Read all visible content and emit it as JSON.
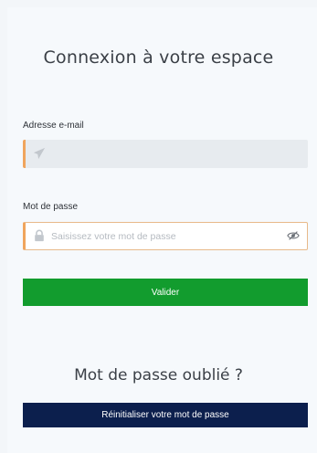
{
  "login": {
    "title": "Connexion à votre espace",
    "email_label": "Adresse e-mail",
    "email_value": "",
    "password_label": "Mot de passe",
    "password_placeholder": "Saisissez votre mot de passe",
    "password_value": "",
    "submit_label": "Valider"
  },
  "forgot": {
    "title": "Mot de passe oublié ?",
    "reset_label": "Réinitialiser votre mot de passe"
  },
  "icons": {
    "email": "send-icon",
    "password": "lock-icon",
    "toggle_visibility": "eye-slash-icon"
  },
  "colors": {
    "background": "#f3f6f9",
    "field_accent": "#f0a55d",
    "submit": "#129c2e",
    "reset": "#0c1f4d",
    "text": "#3b4047"
  }
}
